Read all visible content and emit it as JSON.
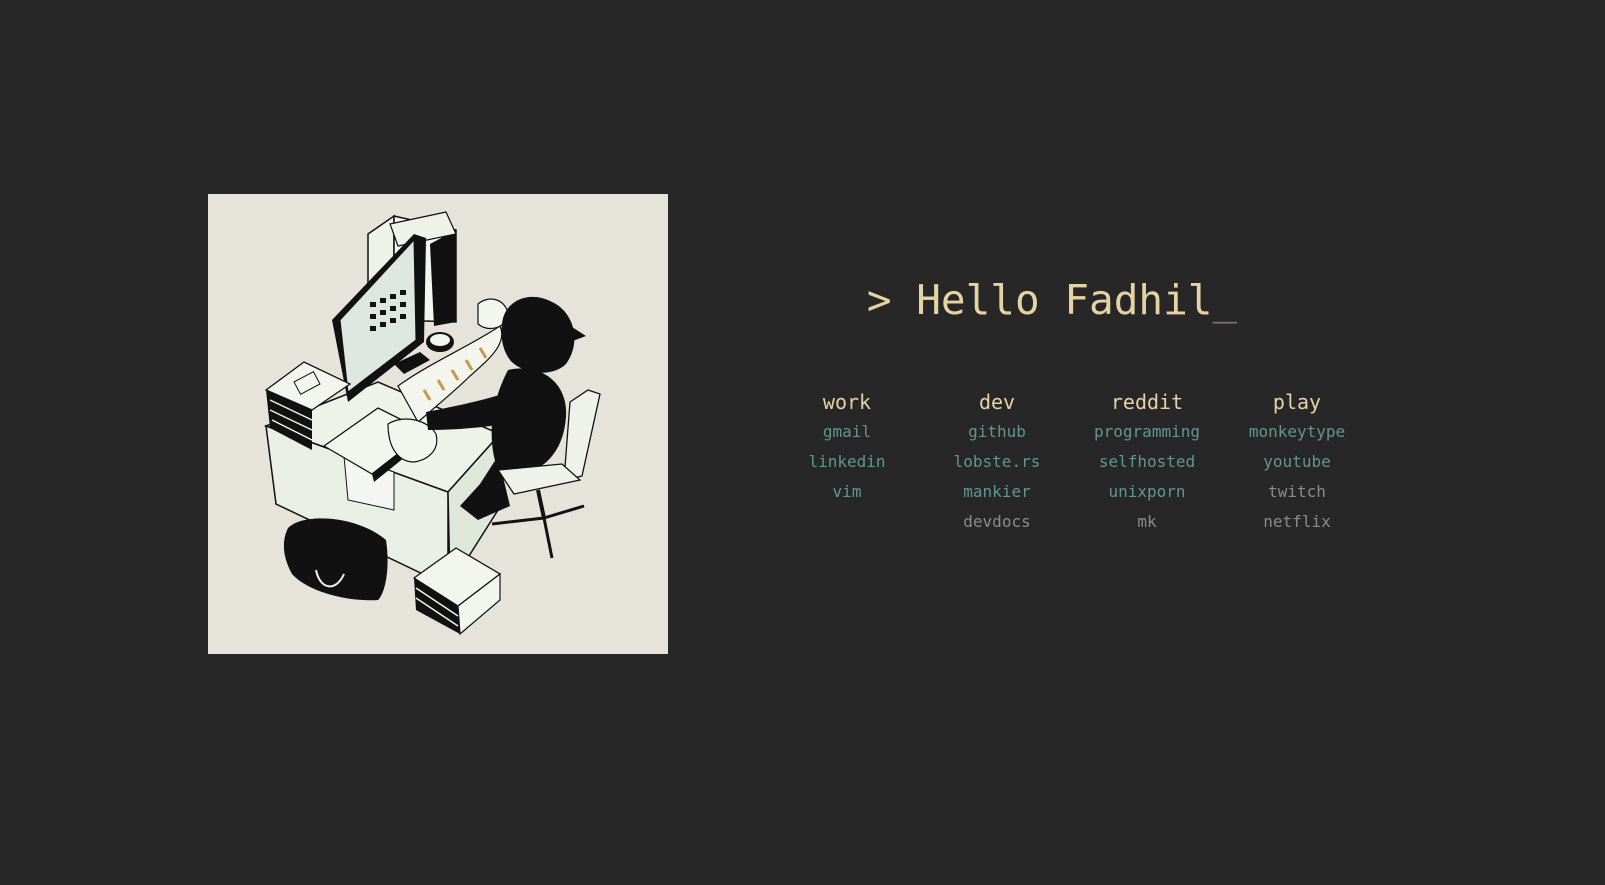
{
  "greeting": {
    "prompt": ">",
    "text": "Hello Fadhil",
    "cursor": "_"
  },
  "colors": {
    "background": "#272727",
    "heading": "#e6d3a3",
    "link": "#5f978f",
    "link_muted": "#8b8b8b",
    "cursor": "#7d745c",
    "illustration_bg": "#e6e4da"
  },
  "illustration": {
    "icon": "desk-illustration"
  },
  "columns": [
    {
      "title": "work",
      "links": [
        "gmail",
        "linkedin",
        "vim"
      ]
    },
    {
      "title": "dev",
      "links": [
        "github",
        "lobste.rs",
        "mankier",
        "devdocs"
      ]
    },
    {
      "title": "reddit",
      "links": [
        "programming",
        "selfhosted",
        "unixporn",
        "mk"
      ]
    },
    {
      "title": "play",
      "links": [
        "monkeytype",
        "youtube",
        "twitch",
        "netflix"
      ]
    }
  ]
}
